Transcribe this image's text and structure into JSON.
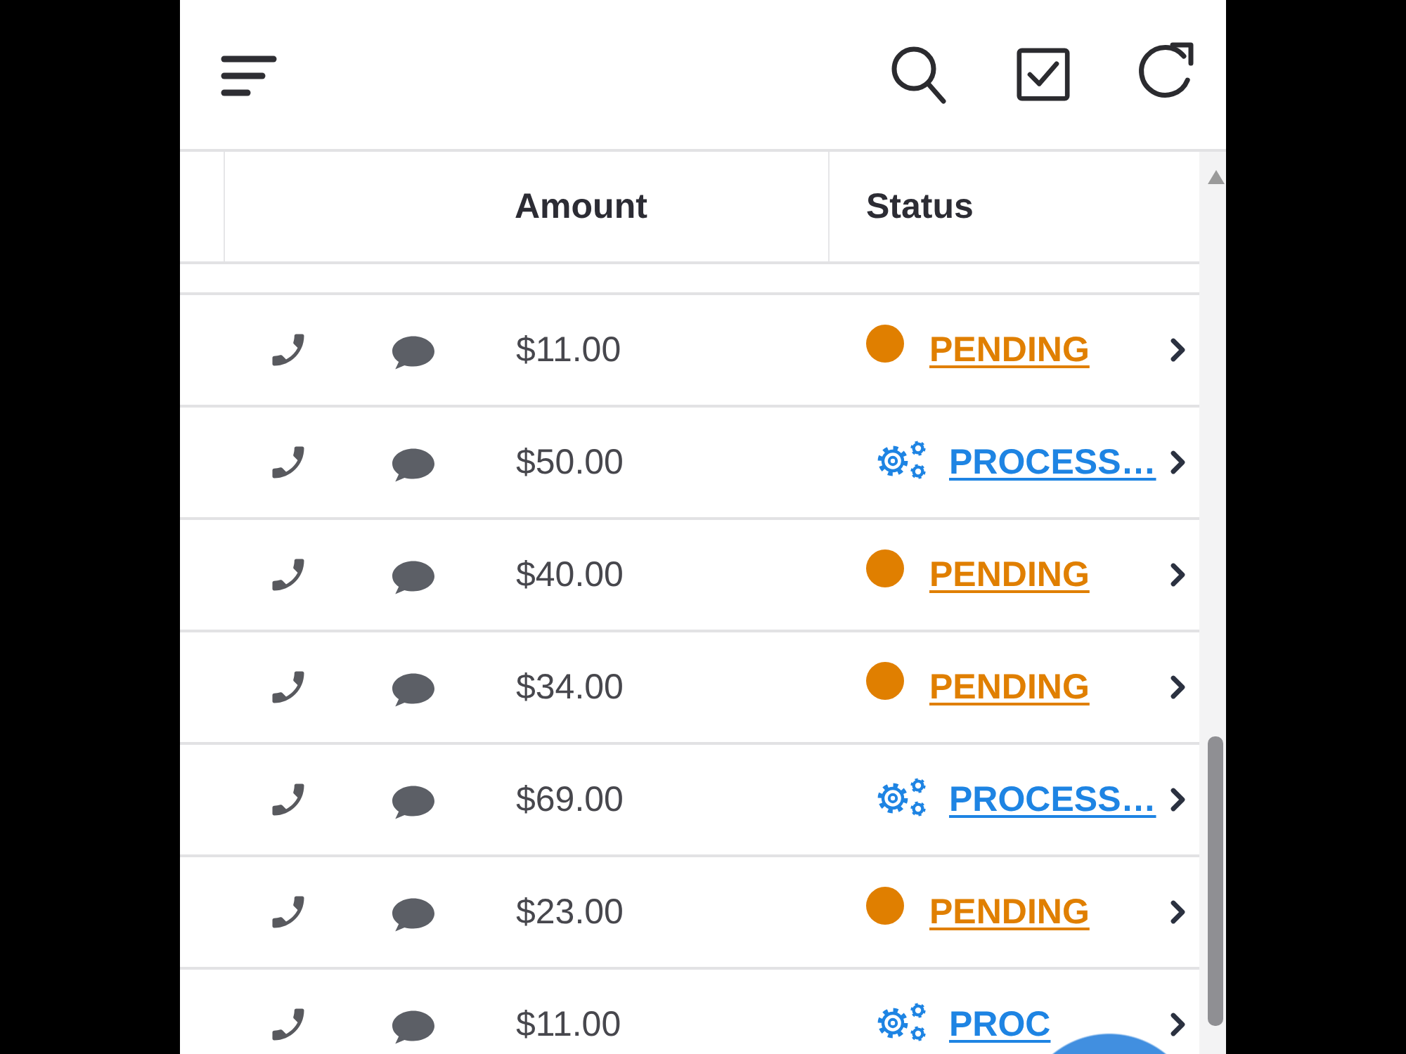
{
  "table": {
    "columns": [
      {
        "label": "Amount"
      },
      {
        "label": "Status"
      }
    ],
    "rows": [
      {
        "amount": "$11.00",
        "status": {
          "kind": "pending",
          "label": "PENDING",
          "color": "#e07f00"
        }
      },
      {
        "amount": "$50.00",
        "status": {
          "kind": "processing",
          "label": "PROCESS…",
          "color": "#1e84e3"
        }
      },
      {
        "amount": "$40.00",
        "status": {
          "kind": "pending",
          "label": "PENDING",
          "color": "#e07f00"
        }
      },
      {
        "amount": "$34.00",
        "status": {
          "kind": "pending",
          "label": "PENDING",
          "color": "#e07f00"
        }
      },
      {
        "amount": "$69.00",
        "status": {
          "kind": "processing",
          "label": "PROCESS…",
          "color": "#1e84e3"
        }
      },
      {
        "amount": "$23.00",
        "status": {
          "kind": "pending",
          "label": "PENDING",
          "color": "#e07f00"
        }
      },
      {
        "amount": "$11.00",
        "status": {
          "kind": "processing",
          "label": "PROC",
          "color": "#1e84e3"
        }
      }
    ]
  }
}
